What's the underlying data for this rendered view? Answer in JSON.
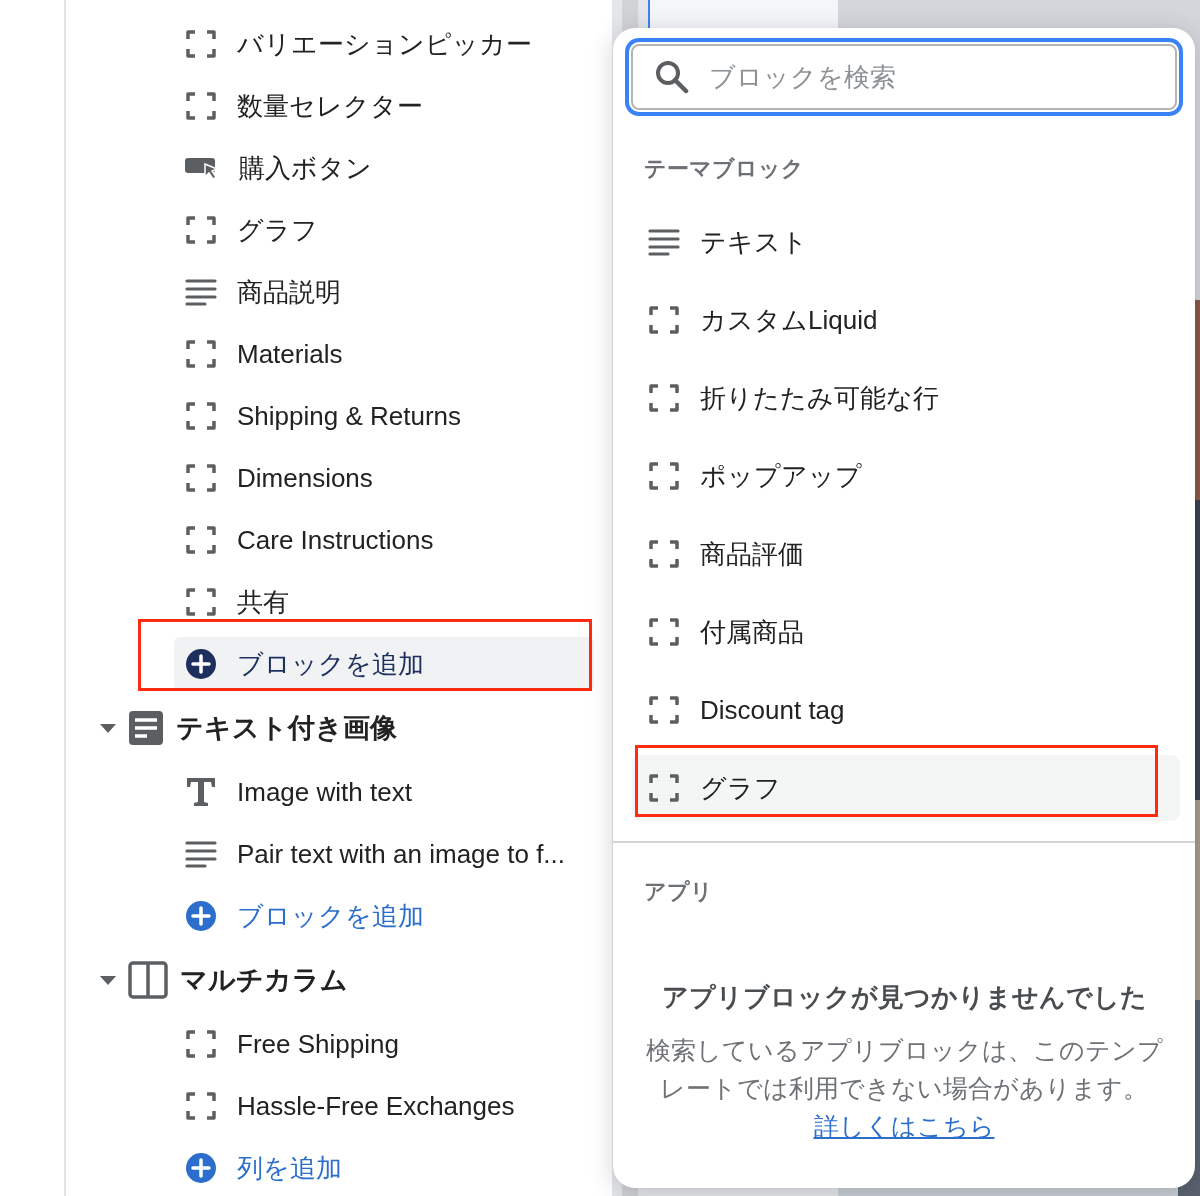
{
  "sidebar": {
    "blocks": [
      {
        "kind": "placeholder",
        "label": "バリエーションピッカー"
      },
      {
        "kind": "placeholder",
        "label": "数量セレクター"
      },
      {
        "kind": "button",
        "label": "購入ボタン"
      },
      {
        "kind": "placeholder",
        "label": "グラフ"
      },
      {
        "kind": "lines",
        "label": "商品説明"
      },
      {
        "kind": "placeholder",
        "label": "Materials"
      },
      {
        "kind": "placeholder",
        "label": "Shipping & Returns"
      },
      {
        "kind": "placeholder",
        "label": "Dimensions"
      },
      {
        "kind": "placeholder",
        "label": "Care Instructions"
      },
      {
        "kind": "placeholder",
        "label": "共有"
      }
    ],
    "add": {
      "label": "ブロックを追加",
      "selected": true
    },
    "sections": [
      {
        "title": "テキスト付き画像",
        "kind": "image-text",
        "expanded": true,
        "children": [
          {
            "kind": "type",
            "label": "Image with text"
          },
          {
            "kind": "lines",
            "label": "Pair text with an image to f..."
          }
        ],
        "add": {
          "label": "ブロックを追加",
          "selected": false
        }
      },
      {
        "title": "マルチカラム",
        "kind": "columns",
        "expanded": true,
        "children": [
          {
            "kind": "placeholder",
            "label": "Free Shipping"
          },
          {
            "kind": "placeholder",
            "label": "Hassle-Free Exchanges"
          }
        ],
        "add": {
          "label": "列を追加",
          "selected": false
        }
      }
    ]
  },
  "picker": {
    "search": {
      "placeholder": "ブロックを検索"
    },
    "theme_blocks": {
      "heading": "テーマブロック",
      "items": [
        {
          "kind": "lines",
          "label": "テキスト",
          "selected": false
        },
        {
          "kind": "placeholder",
          "label": "カスタムLiquid",
          "selected": false
        },
        {
          "kind": "placeholder",
          "label": "折りたたみ可能な行",
          "selected": false
        },
        {
          "kind": "placeholder",
          "label": "ポップアップ",
          "selected": false
        },
        {
          "kind": "placeholder",
          "label": "商品評価",
          "selected": false
        },
        {
          "kind": "placeholder",
          "label": "付属商品",
          "selected": false
        },
        {
          "kind": "placeholder",
          "label": "Discount tag",
          "selected": false
        },
        {
          "kind": "placeholder",
          "label": "グラフ",
          "selected": true
        }
      ]
    },
    "apps": {
      "heading": "アプリ",
      "empty_title": "アプリブロックが見つかりませんでした",
      "empty_text": "検索しているアプリブロックは、このテンプレートでは利用できない場合があります。",
      "link": "詳しくはこちら"
    }
  }
}
